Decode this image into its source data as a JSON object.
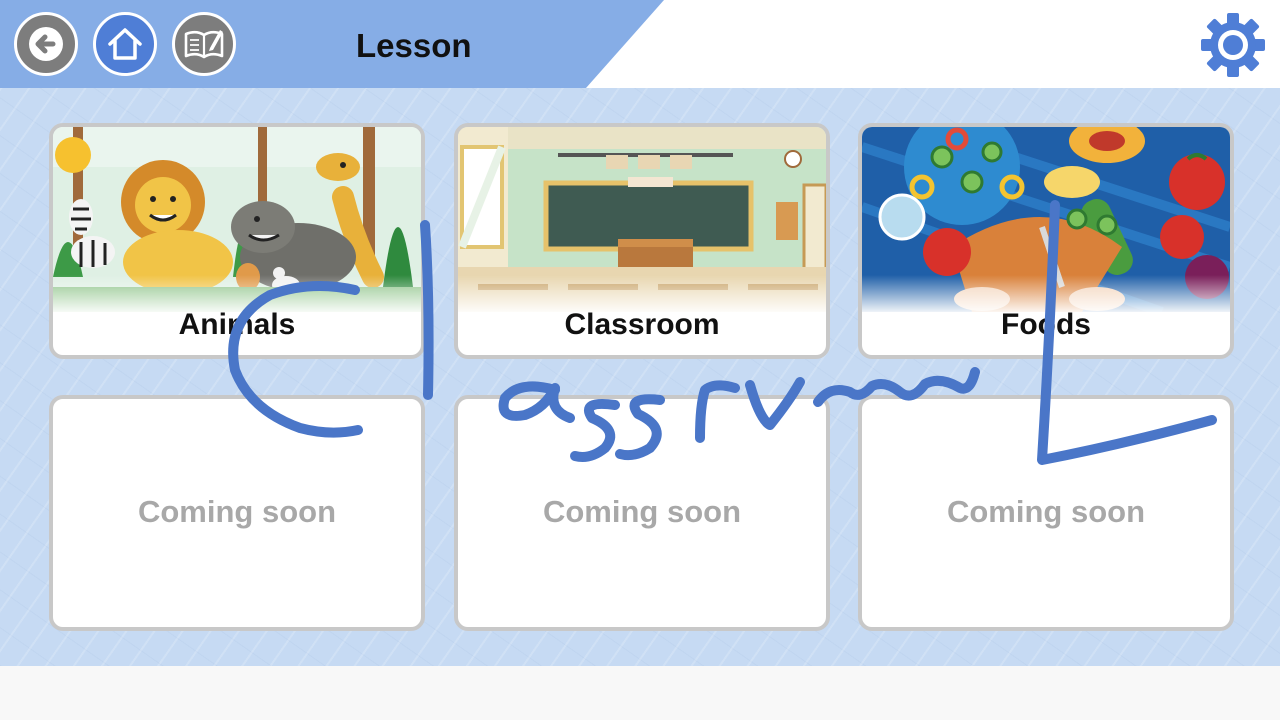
{
  "header": {
    "title": "Lesson",
    "accent_color": "#86ade6",
    "buttons": {
      "back": {
        "icon": "arrow-left-icon",
        "color": "#7d7d7d"
      },
      "home": {
        "icon": "home-icon",
        "color": "#4f7ed6"
      },
      "notebook": {
        "icon": "book-pencil-icon",
        "color": "#7d7d7d"
      },
      "settings": {
        "icon": "gear-icon",
        "color": "#4f7ed6"
      }
    }
  },
  "lessons": [
    {
      "label": "Animals",
      "illustration": "animals-illustration"
    },
    {
      "label": "Classroom",
      "illustration": "classroom-illustration"
    },
    {
      "label": "Foods",
      "illustration": "foods-illustration"
    }
  ],
  "placeholders": [
    {
      "label": "Coming soon"
    },
    {
      "label": "Coming soon"
    },
    {
      "label": "Coming soon"
    }
  ],
  "colors": {
    "content_background": "#c6daf3",
    "card_border": "#c8c8c8",
    "placeholder_text": "#a8a8a8",
    "ink_stroke": "#4a76c8"
  }
}
